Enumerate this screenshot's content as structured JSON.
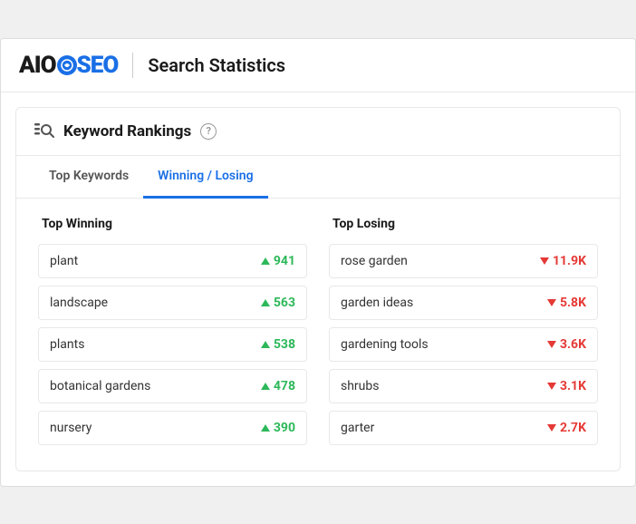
{
  "header": {
    "logo_aio": "AIO",
    "logo_seo": "SEO",
    "page_title": "Search Statistics"
  },
  "card": {
    "title": "Keyword Rankings",
    "help_label": "?",
    "tabs": [
      {
        "id": "top-keywords",
        "label": "Top Keywords",
        "active": false
      },
      {
        "id": "winning-losing",
        "label": "Winning / Losing",
        "active": true
      }
    ],
    "winning": {
      "title": "Top Winning",
      "items": [
        {
          "keyword": "plant",
          "value": "941"
        },
        {
          "keyword": "landscape",
          "value": "563"
        },
        {
          "keyword": "plants",
          "value": "538"
        },
        {
          "keyword": "botanical gardens",
          "value": "478"
        },
        {
          "keyword": "nursery",
          "value": "390"
        }
      ]
    },
    "losing": {
      "title": "Top Losing",
      "items": [
        {
          "keyword": "rose garden",
          "value": "11.9K"
        },
        {
          "keyword": "garden ideas",
          "value": "5.8K"
        },
        {
          "keyword": "gardening tools",
          "value": "3.6K"
        },
        {
          "keyword": "shrubs",
          "value": "3.1K"
        },
        {
          "keyword": "garter",
          "value": "2.7K"
        }
      ]
    }
  }
}
